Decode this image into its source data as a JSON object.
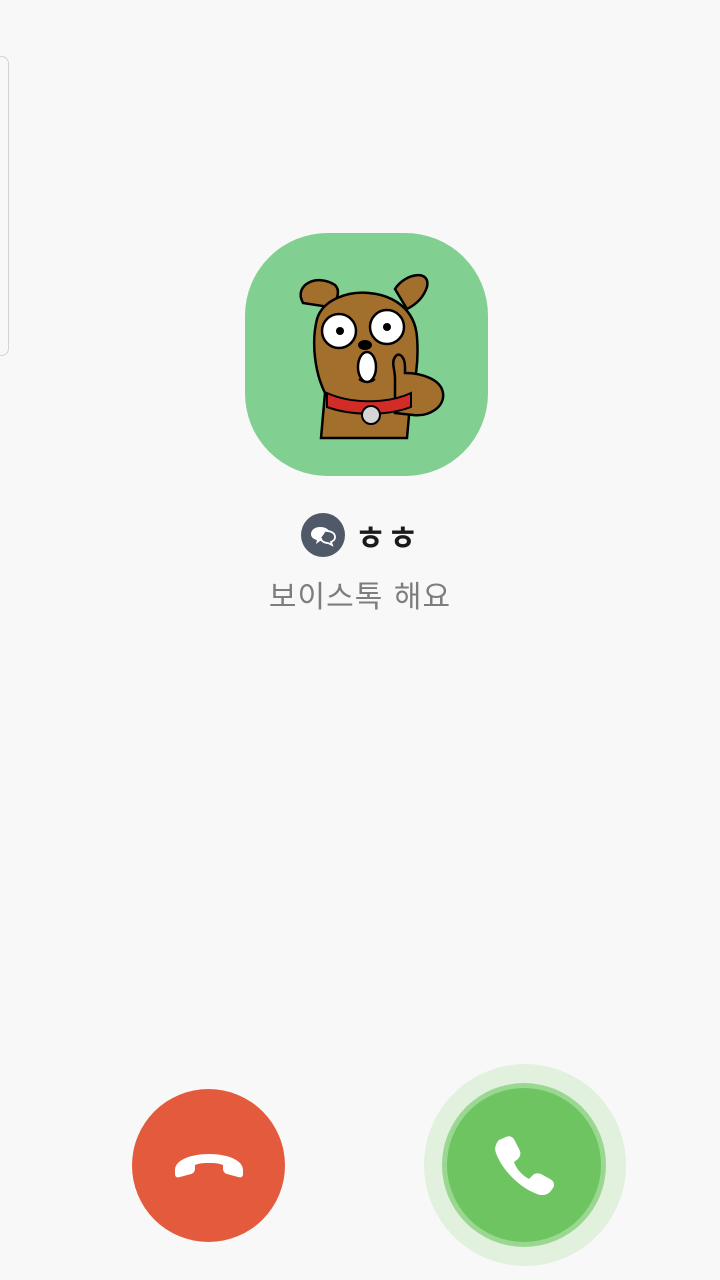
{
  "caller": {
    "name": "ㅎㅎ",
    "status": "보이스톡 해요",
    "avatar_icon": "dog-thumbs-up-avatar",
    "badge_icon": "kakaotalk-chat-bubble-icon"
  },
  "actions": {
    "decline_icon": "phone-hangup-icon",
    "accept_icon": "phone-handset-icon"
  },
  "colors": {
    "background": "#f8f8f8",
    "avatar_bg": "#82cf92",
    "decline": "#e35a3d",
    "accept": "#6ec461",
    "accept_halo": "#e1f1de",
    "badge": "#4f5967"
  }
}
